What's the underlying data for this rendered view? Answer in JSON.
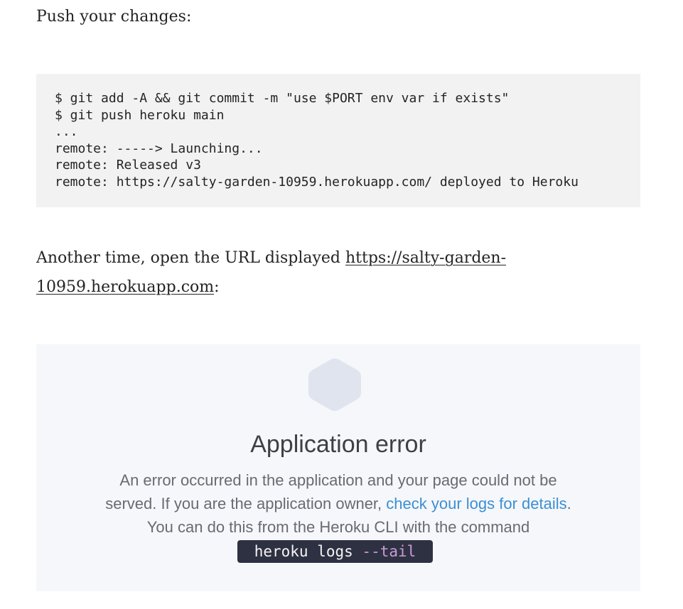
{
  "intro": {
    "text": "Push your changes:"
  },
  "code_block": {
    "lines": [
      "$ git add -A && git commit -m \"use $PORT env var if exists\"",
      "$ git push heroku main",
      "...",
      "remote: -----> Launching...",
      "remote: Released v3",
      "remote: https://salty-garden-10959.herokuapp.com/ deployed to Heroku"
    ]
  },
  "another_time": {
    "prefix": "Another time, open the URL displayed ",
    "link_text": "https://salty-garden-10959.herokuapp.com",
    "suffix": ":"
  },
  "error_page": {
    "icon": "hexagon-icon",
    "icon_color": "#dfe4ee",
    "background": "#f6f7fa",
    "title": "Application error",
    "line1": "An error occurred in the application and your page could not be",
    "line2_prefix": "served. If you are the application owner, ",
    "line2_link": "check your logs for details",
    "line2_suffix": ".",
    "line3": "You can do this from the Heroku CLI with the command",
    "command_main": "heroku logs ",
    "command_flag": "--tail",
    "link_color": "#3b8fd4"
  }
}
